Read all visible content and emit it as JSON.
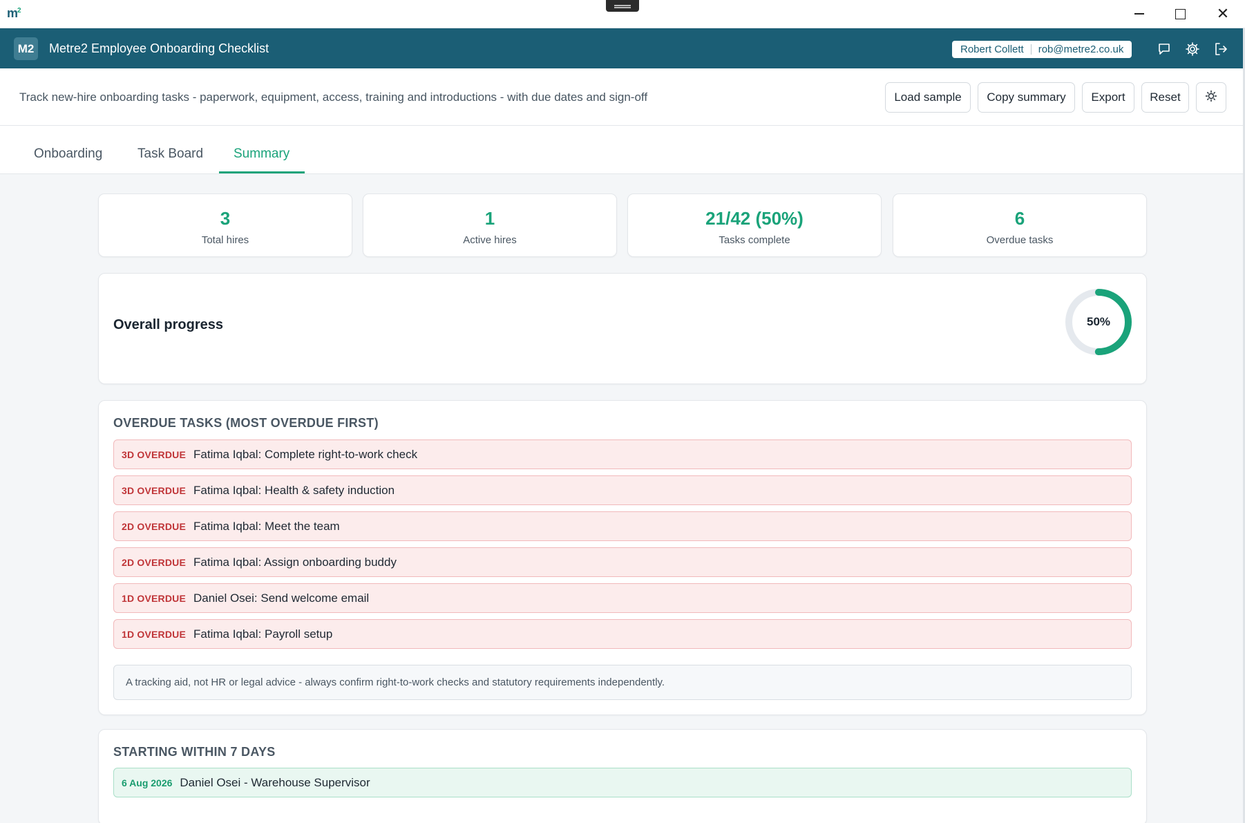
{
  "window": {
    "logo": "m",
    "logo_sup": "2",
    "icons": [
      "minimize-icon",
      "maximize-icon",
      "close-icon"
    ]
  },
  "header": {
    "badge": "M2",
    "title": "Metre2 Employee Onboarding Checklist",
    "user_name": "Robert Collett",
    "user_email": "rob@metre2.co.uk",
    "icons": [
      "feedback-icon",
      "settings-icon",
      "logout-icon"
    ],
    "brand_color": "#1b5e75"
  },
  "toolbar": {
    "description": "Track new-hire onboarding tasks - paperwork, equipment, access, training and introductions - with due dates and sign-off",
    "load_sample": "Load sample",
    "copy_summary": "Copy summary",
    "export": "Export",
    "reset": "Reset",
    "theme_icon": "sun-icon"
  },
  "tabs": [
    {
      "label": "Onboarding",
      "active": false
    },
    {
      "label": "Task Board",
      "active": false
    },
    {
      "label": "Summary",
      "active": true
    }
  ],
  "stats": [
    {
      "value": "3",
      "label": "Total hires"
    },
    {
      "value": "1",
      "label": "Active hires"
    },
    {
      "value": "21/42 (50%)",
      "label": "Tasks complete"
    },
    {
      "value": "6",
      "label": "Overdue tasks"
    }
  ],
  "progress": {
    "title": "Overall progress",
    "percent_label": "50%",
    "fraction": 0.5,
    "accent_color": "#1aa37a"
  },
  "overdue": {
    "title": "OVERDUE TASKS (MOST OVERDUE FIRST)",
    "items": [
      {
        "tag": "3D OVERDUE",
        "text": "Fatima Iqbal: Complete right-to-work check"
      },
      {
        "tag": "3D OVERDUE",
        "text": "Fatima Iqbal: Health & safety induction"
      },
      {
        "tag": "2D OVERDUE",
        "text": "Fatima Iqbal: Meet the team"
      },
      {
        "tag": "2D OVERDUE",
        "text": "Fatima Iqbal: Assign onboarding buddy"
      },
      {
        "tag": "1D OVERDUE",
        "text": "Daniel Osei: Send welcome email"
      },
      {
        "tag": "1D OVERDUE",
        "text": "Fatima Iqbal: Payroll setup"
      }
    ],
    "disclaimer": "A tracking aid, not HR or legal advice - always confirm right-to-work checks and statutory requirements independently.",
    "alert_color": "#c03538"
  },
  "starting": {
    "title": "STARTING WITHIN 7 DAYS",
    "items": [
      {
        "date": "6 Aug 2026",
        "text": "Daniel Osei - Warehouse Supervisor"
      }
    ]
  }
}
